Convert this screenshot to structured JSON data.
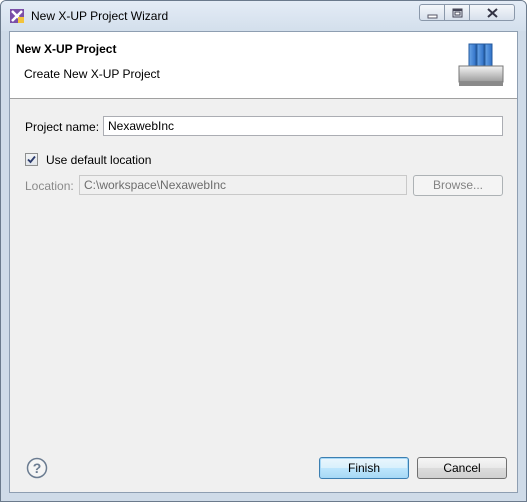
{
  "window": {
    "title": "New X-UP Project Wizard",
    "icon": "xup-app-icon",
    "controls": [
      "minimize-icon",
      "maximize-icon",
      "close-icon"
    ]
  },
  "header": {
    "title": "New X-UP Project",
    "description": "Create New X-UP Project",
    "icon": "wizard-banner-icon"
  },
  "form": {
    "project_name_label": "Project name:",
    "project_name_value": "NexawebInc",
    "use_default_location_label": "Use default location",
    "use_default_location_checked": true,
    "location_label": "Location:",
    "location_value": "C:\\workspace\\NexawebInc",
    "browse_label": "Browse..."
  },
  "footer": {
    "help_icon": "help-icon",
    "finish_label": "Finish",
    "cancel_label": "Cancel"
  }
}
